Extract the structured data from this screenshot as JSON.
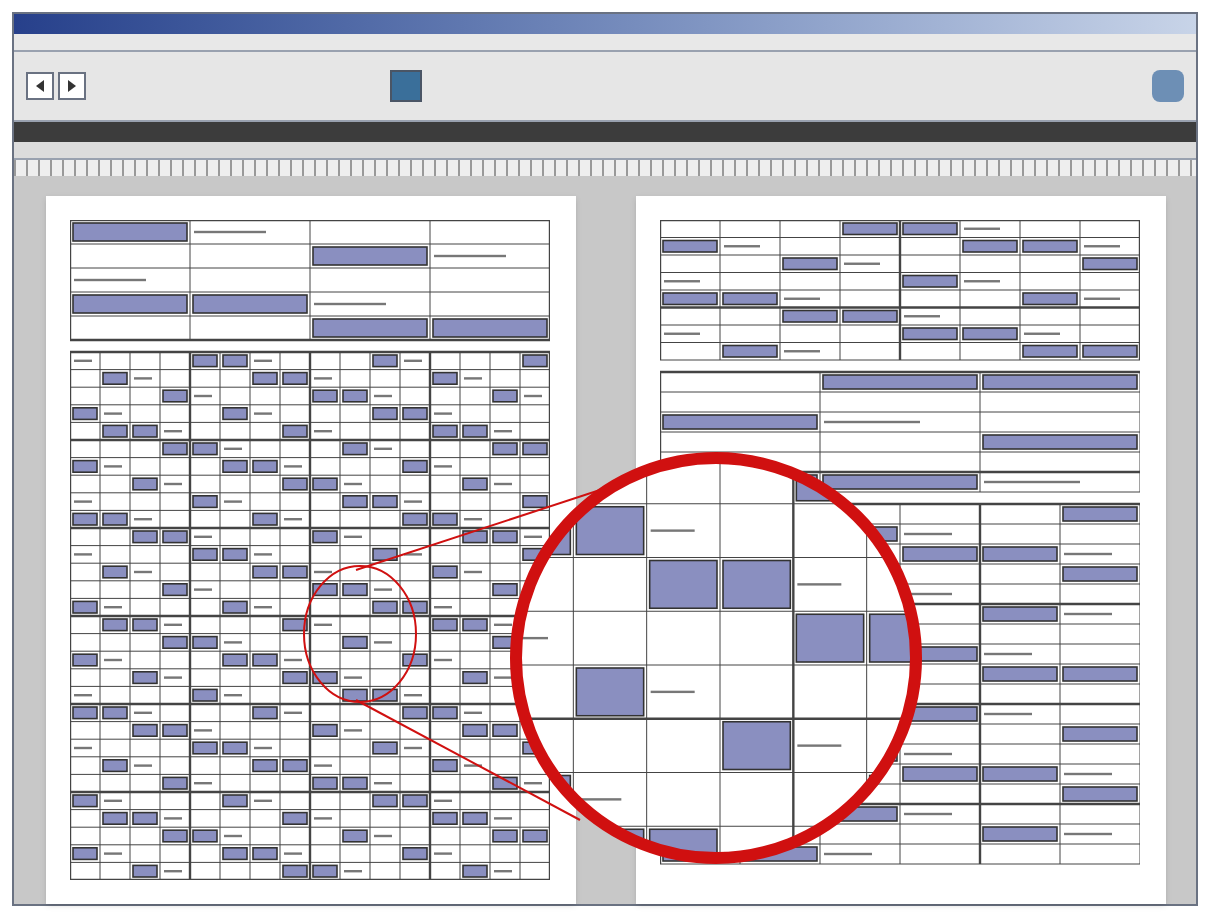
{
  "toolbar": {
    "buttons": [
      {
        "kind": "back"
      },
      {
        "kind": "forward"
      },
      {
        "kind": "grid"
      },
      {
        "kind": "save"
      }
    ]
  },
  "pages": [
    {
      "kind": "form-left"
    },
    {
      "kind": "form-right"
    }
  ],
  "magnifier": {
    "visible": true
  }
}
